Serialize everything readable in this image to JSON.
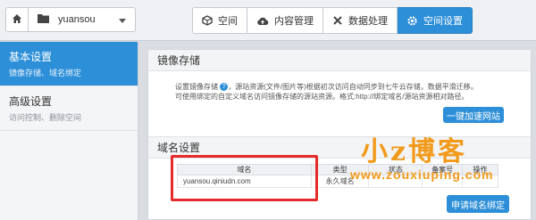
{
  "topbar": {
    "bucket_name": "yuansou",
    "tabs": [
      {
        "label": "空间",
        "icon": "cube-icon"
      },
      {
        "label": "内容管理",
        "icon": "cloud-upload-icon"
      },
      {
        "label": "数据处理",
        "icon": "tools-icon"
      },
      {
        "label": "空间设置",
        "icon": "gear-icon",
        "active": true
      }
    ]
  },
  "sidebar": {
    "items": [
      {
        "title": "基本设置",
        "subtitle": "镜像存储、域名绑定",
        "active": true
      },
      {
        "title": "高级设置",
        "subtitle": "访问控制、删除空间"
      }
    ]
  },
  "mirror": {
    "heading": "镜像存储",
    "desc_line1": "设置镜像存储",
    "desc_line1_rest": "，源站资源(文件/图片等)根据初次访问自动同步到七牛云存储，数据平滑迁移。",
    "desc_line2": "可使用绑定的自定义域名访问镜像存储的源站资源。格式:http://绑定域名/源站资源相对路径。",
    "accel_button": "一键加速网站"
  },
  "domain": {
    "heading": "域名设置",
    "columns": [
      "域名",
      "类型",
      "状态",
      "备案号",
      "操作"
    ],
    "rows": [
      {
        "domain": "yuansou.qiniudn.com",
        "type": "永久域名",
        "status": "",
        "icp": "",
        "op": ""
      }
    ],
    "apply_button": "申请域名绑定"
  },
  "watermark": {
    "brand": "小z博客",
    "url": "www.zouxiuping.com"
  },
  "colors": {
    "accent": "#2d8fd8",
    "highlight_box": "#e52b2b",
    "watermark": "#f29a1a"
  }
}
